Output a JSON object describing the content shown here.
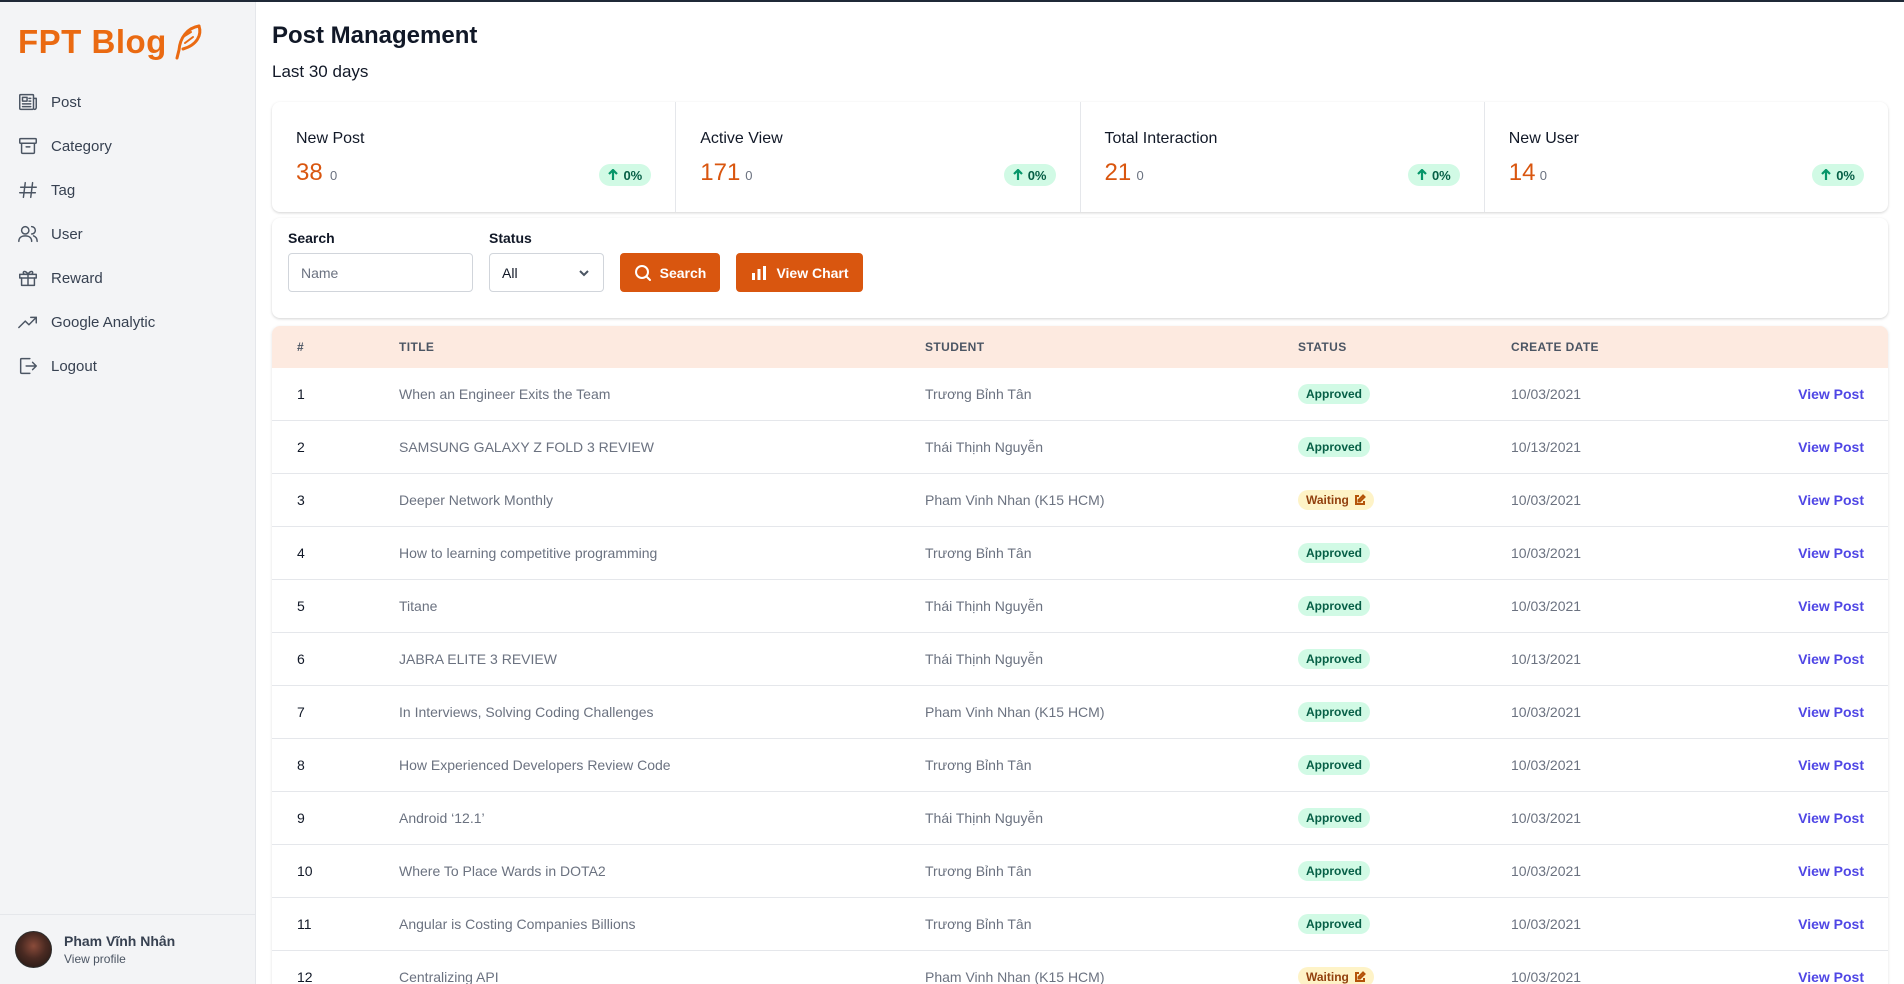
{
  "app": {
    "brand": "FPT Blog"
  },
  "sidebar": {
    "items": [
      {
        "label": "Post",
        "icon": "newspaper-icon"
      },
      {
        "label": "Category",
        "icon": "archive-box-icon"
      },
      {
        "label": "Tag",
        "icon": "hashtag-icon"
      },
      {
        "label": "User",
        "icon": "users-icon"
      },
      {
        "label": "Reward",
        "icon": "gift-icon"
      },
      {
        "label": "Google Analytic",
        "icon": "trending-up-icon"
      },
      {
        "label": "Logout",
        "icon": "logout-icon"
      }
    ],
    "profile": {
      "name": "Pham Vĩnh Nhân",
      "link": "View profile"
    }
  },
  "page": {
    "title": "Post Management",
    "subtitle": "Last 30 days"
  },
  "stats": [
    {
      "label": "New Post",
      "value": "38",
      "previous": "0",
      "change": "0%"
    },
    {
      "label": "Active View",
      "value": "171",
      "previous": "0",
      "change": "0%"
    },
    {
      "label": "Total Interaction",
      "value": "21",
      "previous": "0",
      "change": "0%"
    },
    {
      "label": "New User",
      "value": "14",
      "previous": "0",
      "change": "0%"
    }
  ],
  "filters": {
    "search_label": "Search",
    "search_placeholder": "Name",
    "status_label": "Status",
    "status_value": "All",
    "search_button": "Search",
    "chart_button": "View Chart"
  },
  "table": {
    "headers": {
      "num": "#",
      "title": "TITLE",
      "student": "STUDENT",
      "status": "STATUS",
      "date": "CREATE DATE"
    },
    "action_label": "View Post",
    "rows": [
      {
        "num": "1",
        "title": "When an Engineer Exits the Team",
        "student": "Trương Bỉnh Tân",
        "status": "Approved",
        "date": "10/03/2021"
      },
      {
        "num": "2",
        "title": "SAMSUNG GALAXY Z FOLD 3 REVIEW",
        "student": "Thái Thịnh Nguyễn",
        "status": "Approved",
        "date": "10/13/2021"
      },
      {
        "num": "3",
        "title": "Deeper Network Monthly",
        "student": "Pham Vinh Nhan (K15 HCM)",
        "status": "Waiting",
        "date": "10/03/2021"
      },
      {
        "num": "4",
        "title": "How to learning competitive programming",
        "student": "Trương Bỉnh Tân",
        "status": "Approved",
        "date": "10/03/2021"
      },
      {
        "num": "5",
        "title": "Titane",
        "student": "Thái Thịnh Nguyễn",
        "status": "Approved",
        "date": "10/03/2021"
      },
      {
        "num": "6",
        "title": "JABRA ELITE 3 REVIEW",
        "student": "Thái Thịnh Nguyễn",
        "status": "Approved",
        "date": "10/13/2021"
      },
      {
        "num": "7",
        "title": "In Interviews, Solving Coding Challenges",
        "student": "Pham Vinh Nhan (K15 HCM)",
        "status": "Approved",
        "date": "10/03/2021"
      },
      {
        "num": "8",
        "title": "How Experienced Developers Review Code",
        "student": "Trương Bỉnh Tân",
        "status": "Approved",
        "date": "10/03/2021"
      },
      {
        "num": "9",
        "title": "Android ‘12.1’",
        "student": "Thái Thịnh Nguyễn",
        "status": "Approved",
        "date": "10/03/2021"
      },
      {
        "num": "10",
        "title": "Where To Place Wards in DOTA2",
        "student": "Trương Bỉnh Tân",
        "status": "Approved",
        "date": "10/03/2021"
      },
      {
        "num": "11",
        "title": "Angular is Costing Companies Billions",
        "student": "Trương Bỉnh Tân",
        "status": "Approved",
        "date": "10/03/2021"
      },
      {
        "num": "12",
        "title": "Centralizing API",
        "student": "Pham Vinh Nhan (K15 HCM)",
        "status": "Waiting",
        "date": "10/03/2021"
      }
    ]
  },
  "colors": {
    "brand": "#ea6a12",
    "accent": "#d9560f",
    "approved_bg": "#d1fae5",
    "waiting_bg": "#fef3c7",
    "link": "#4f46e5"
  }
}
